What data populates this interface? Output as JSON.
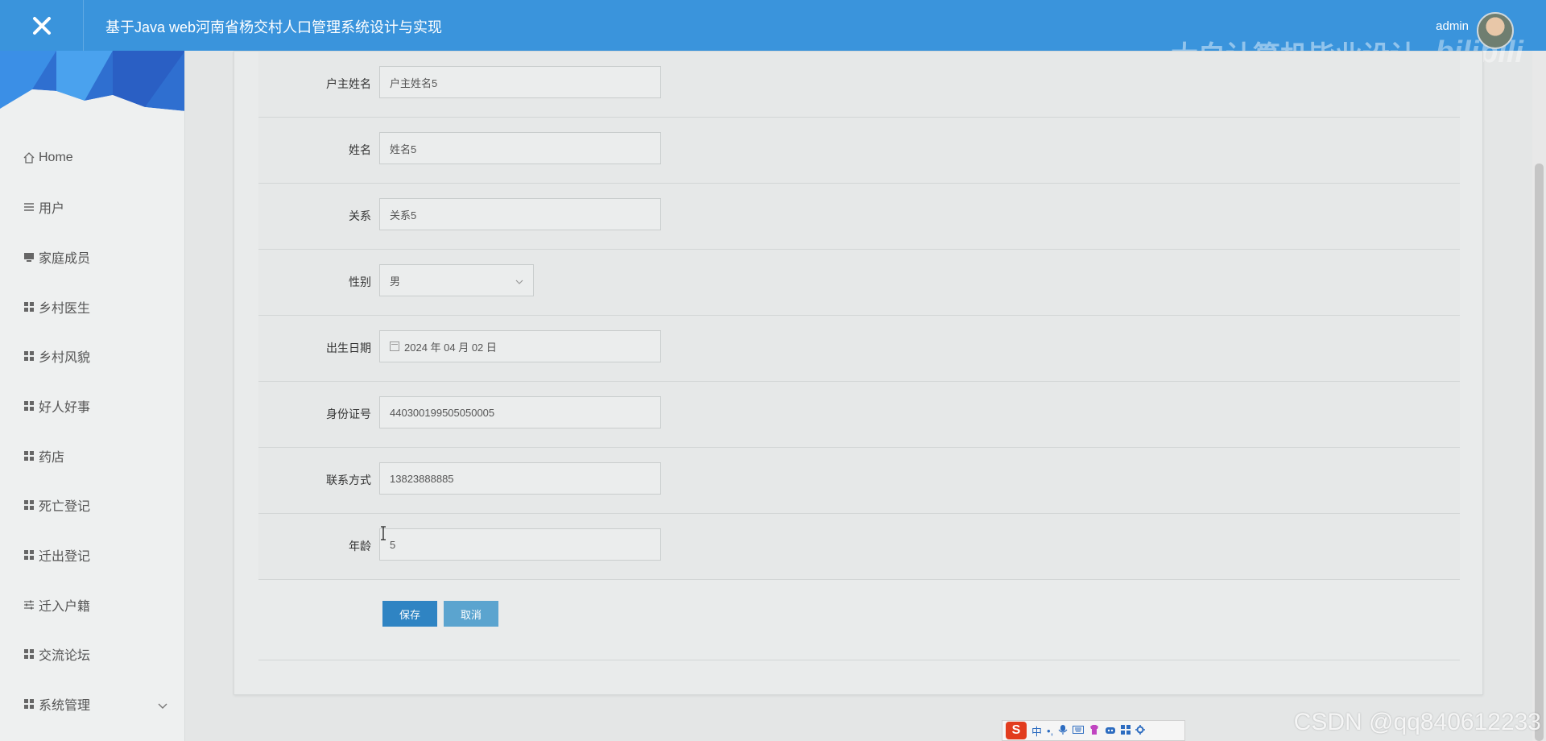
{
  "header": {
    "title": "基于Java web河南省杨交村人口管理系统设计与实现",
    "user": "admin",
    "watermark": "大白计算机毕业设计",
    "bili_logo": "bilibili",
    "accent_color": "#3a94dc"
  },
  "sidebar": {
    "items": [
      {
        "label": "Home",
        "icon": "home-icon"
      },
      {
        "label": "用户",
        "icon": "list-icon"
      },
      {
        "label": "家庭成员",
        "icon": "monitor-icon"
      },
      {
        "label": "乡村医生",
        "icon": "grid-icon"
      },
      {
        "label": "乡村风貌",
        "icon": "grid-icon"
      },
      {
        "label": "好人好事",
        "icon": "grid-icon"
      },
      {
        "label": "药店",
        "icon": "grid-icon"
      },
      {
        "label": "死亡登记",
        "icon": "grid-icon"
      },
      {
        "label": "迁出登记",
        "icon": "grid-icon"
      },
      {
        "label": "迁入户籍",
        "icon": "sliders-icon"
      },
      {
        "label": "交流论坛",
        "icon": "grid-icon"
      },
      {
        "label": "系统管理",
        "icon": "grid-icon",
        "expandable": true
      }
    ]
  },
  "form": {
    "rows": [
      {
        "label": "户主姓名",
        "value": "户主姓名5",
        "type": "text"
      },
      {
        "label": "姓名",
        "value": "姓名5",
        "type": "text"
      },
      {
        "label": "关系",
        "value": "关系5",
        "type": "text"
      },
      {
        "label": "性别",
        "value": "男",
        "type": "select"
      },
      {
        "label": "出生日期",
        "value": "2024 年 04 月 02 日",
        "type": "date"
      },
      {
        "label": "身份证号",
        "value": "440300199505050005",
        "type": "text"
      },
      {
        "label": "联系方式",
        "value": "13823888885",
        "type": "text"
      },
      {
        "label": "年龄",
        "value": "5",
        "type": "text"
      }
    ],
    "save_label": "保存",
    "cancel_label": "取消"
  },
  "ime": {
    "logo": "S",
    "mode": "中",
    "punct": "•,"
  },
  "csdn_watermark": "CSDN @qq840612233"
}
